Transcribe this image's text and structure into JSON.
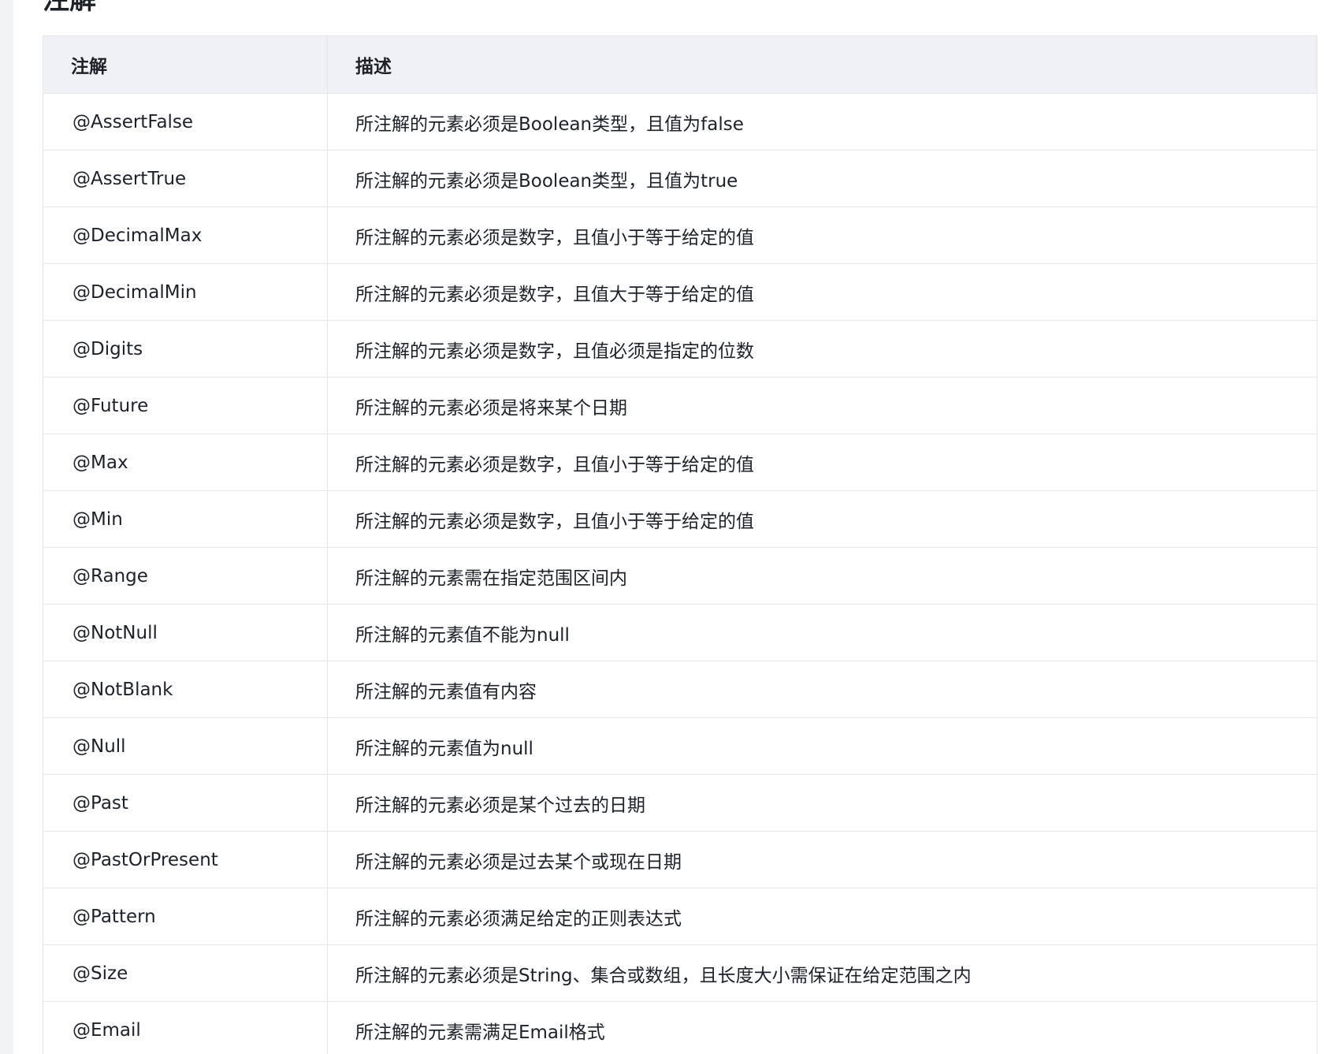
{
  "section": {
    "title": "注解"
  },
  "table": {
    "headers": [
      "注解",
      "描述"
    ],
    "rows": [
      {
        "annotation": "@AssertFalse",
        "description": "所注解的元素必须是Boolean类型，且值为false"
      },
      {
        "annotation": "@AssertTrue",
        "description": "所注解的元素必须是Boolean类型，且值为true"
      },
      {
        "annotation": "@DecimalMax",
        "description": "所注解的元素必须是数字，且值小于等于给定的值"
      },
      {
        "annotation": "@DecimalMin",
        "description": "所注解的元素必须是数字，且值大于等于给定的值"
      },
      {
        "annotation": "@Digits",
        "description": "所注解的元素必须是数字，且值必须是指定的位数"
      },
      {
        "annotation": "@Future",
        "description": "所注解的元素必须是将来某个日期"
      },
      {
        "annotation": "@Max",
        "description": "所注解的元素必须是数字，且值小于等于给定的值"
      },
      {
        "annotation": "@Min",
        "description": "所注解的元素必须是数字，且值小于等于给定的值"
      },
      {
        "annotation": "@Range",
        "description": "所注解的元素需在指定范围区间内"
      },
      {
        "annotation": "@NotNull",
        "description": "所注解的元素值不能为null"
      },
      {
        "annotation": "@NotBlank",
        "description": "所注解的元素值有内容"
      },
      {
        "annotation": "@Null",
        "description": "所注解的元素值为null"
      },
      {
        "annotation": "@Past",
        "description": "所注解的元素必须是某个过去的日期"
      },
      {
        "annotation": "@PastOrPresent",
        "description": "所注解的元素必须是过去某个或现在日期"
      },
      {
        "annotation": "@Pattern",
        "description": "所注解的元素必须满足给定的正则表达式"
      },
      {
        "annotation": "@Size",
        "description": "所注解的元素必须是String、集合或数组，且长度大小需保证在给定范围之内"
      },
      {
        "annotation": "@Email",
        "description": "所注解的元素需满足Email格式"
      }
    ]
  }
}
